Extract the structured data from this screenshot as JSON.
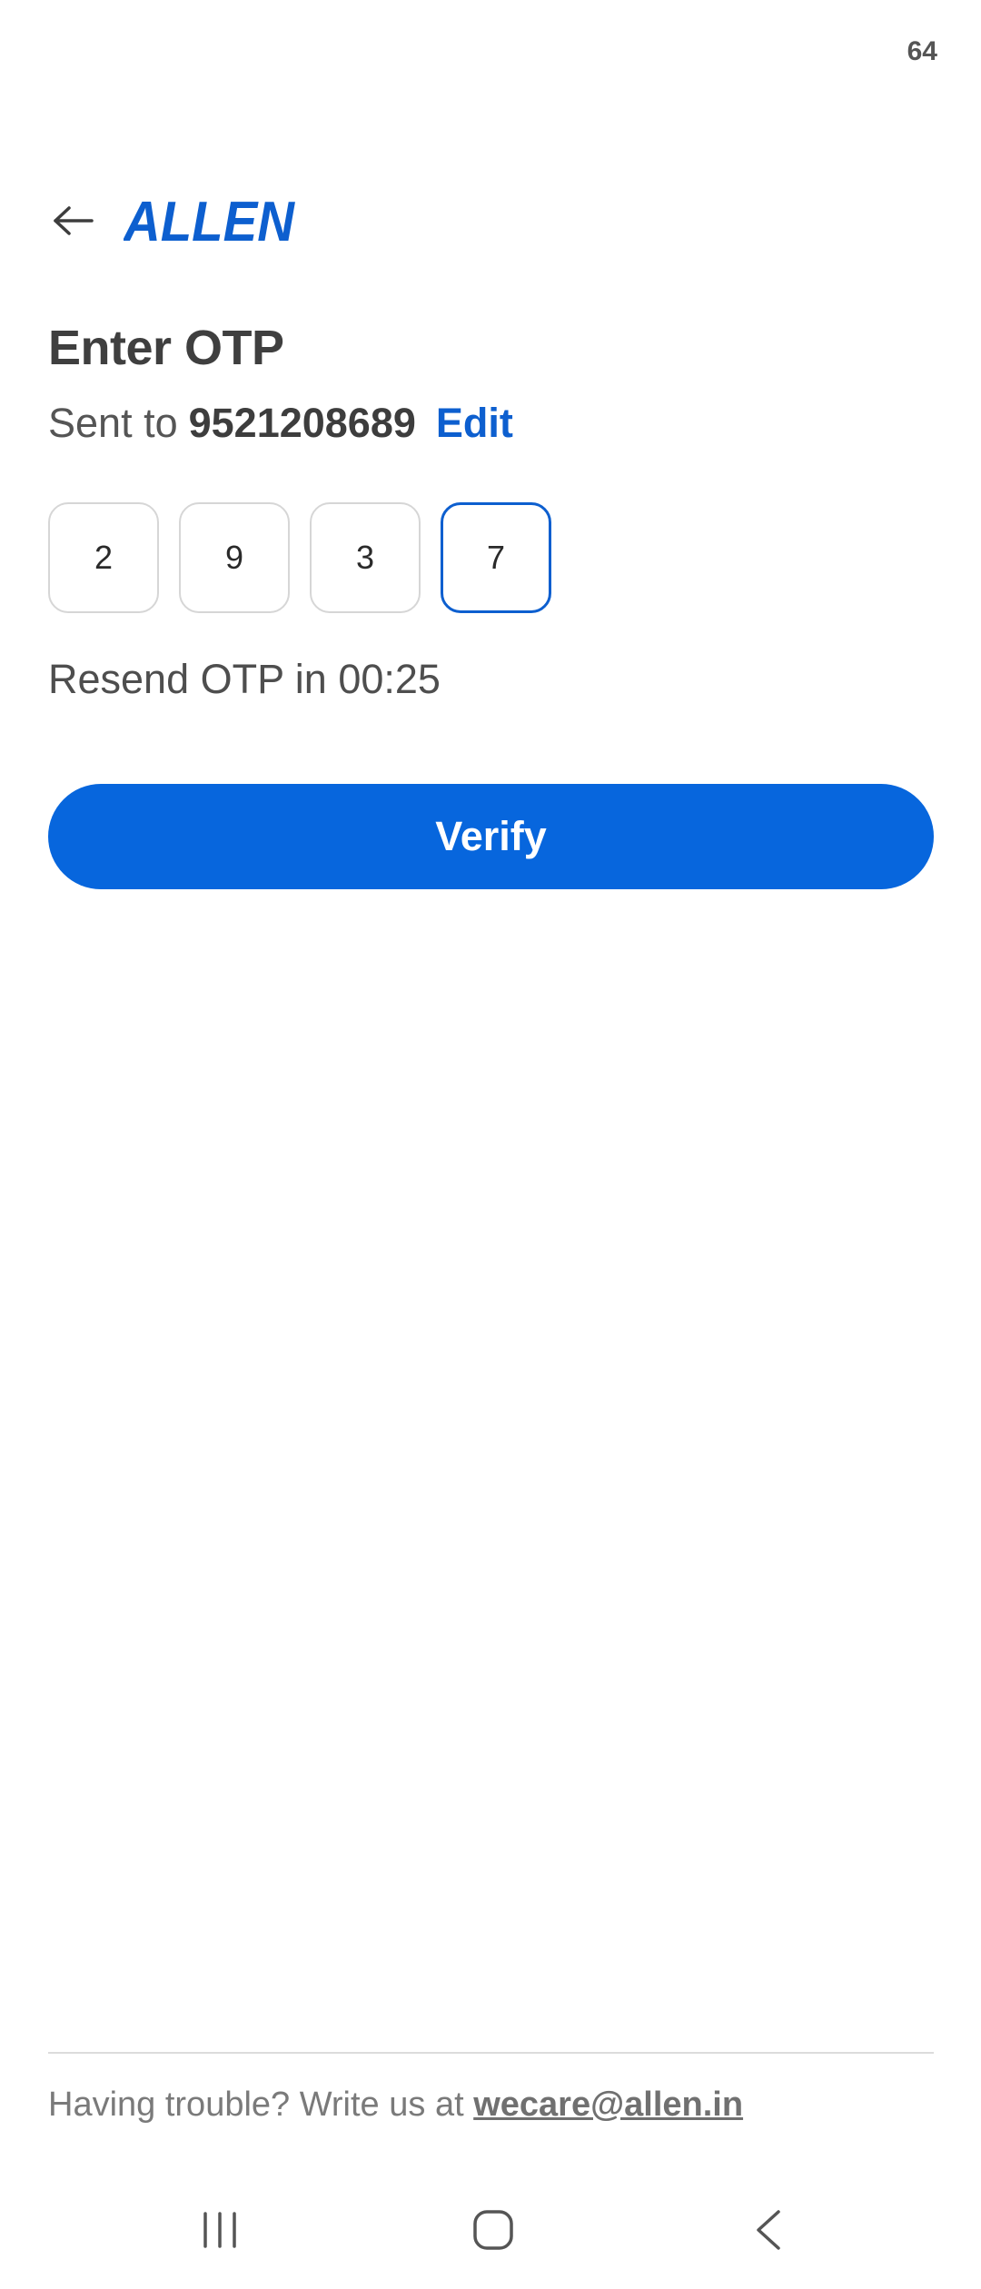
{
  "status_bar": {
    "number": "64"
  },
  "header": {
    "logo_text": "ALLEN",
    "back_icon": "arrow-left-icon"
  },
  "otp": {
    "title": "Enter OTP",
    "sent_prefix": "Sent to",
    "phone": "9521208689",
    "edit_label": "Edit",
    "digits": [
      "2",
      "9",
      "3",
      "7"
    ],
    "resend_text": "Resend OTP in 00:25"
  },
  "verify_label": "Verify",
  "footer": {
    "trouble_text": "Having trouble? Write us at",
    "email": "wecare@allen.in"
  },
  "nav": {
    "recents_icon": "recents-icon",
    "home_icon": "home-icon",
    "back_icon": "chevron-left-icon"
  },
  "colors": {
    "accent": "#0766dd",
    "link": "#0d5fcf",
    "brand": "#0d5fcf"
  }
}
